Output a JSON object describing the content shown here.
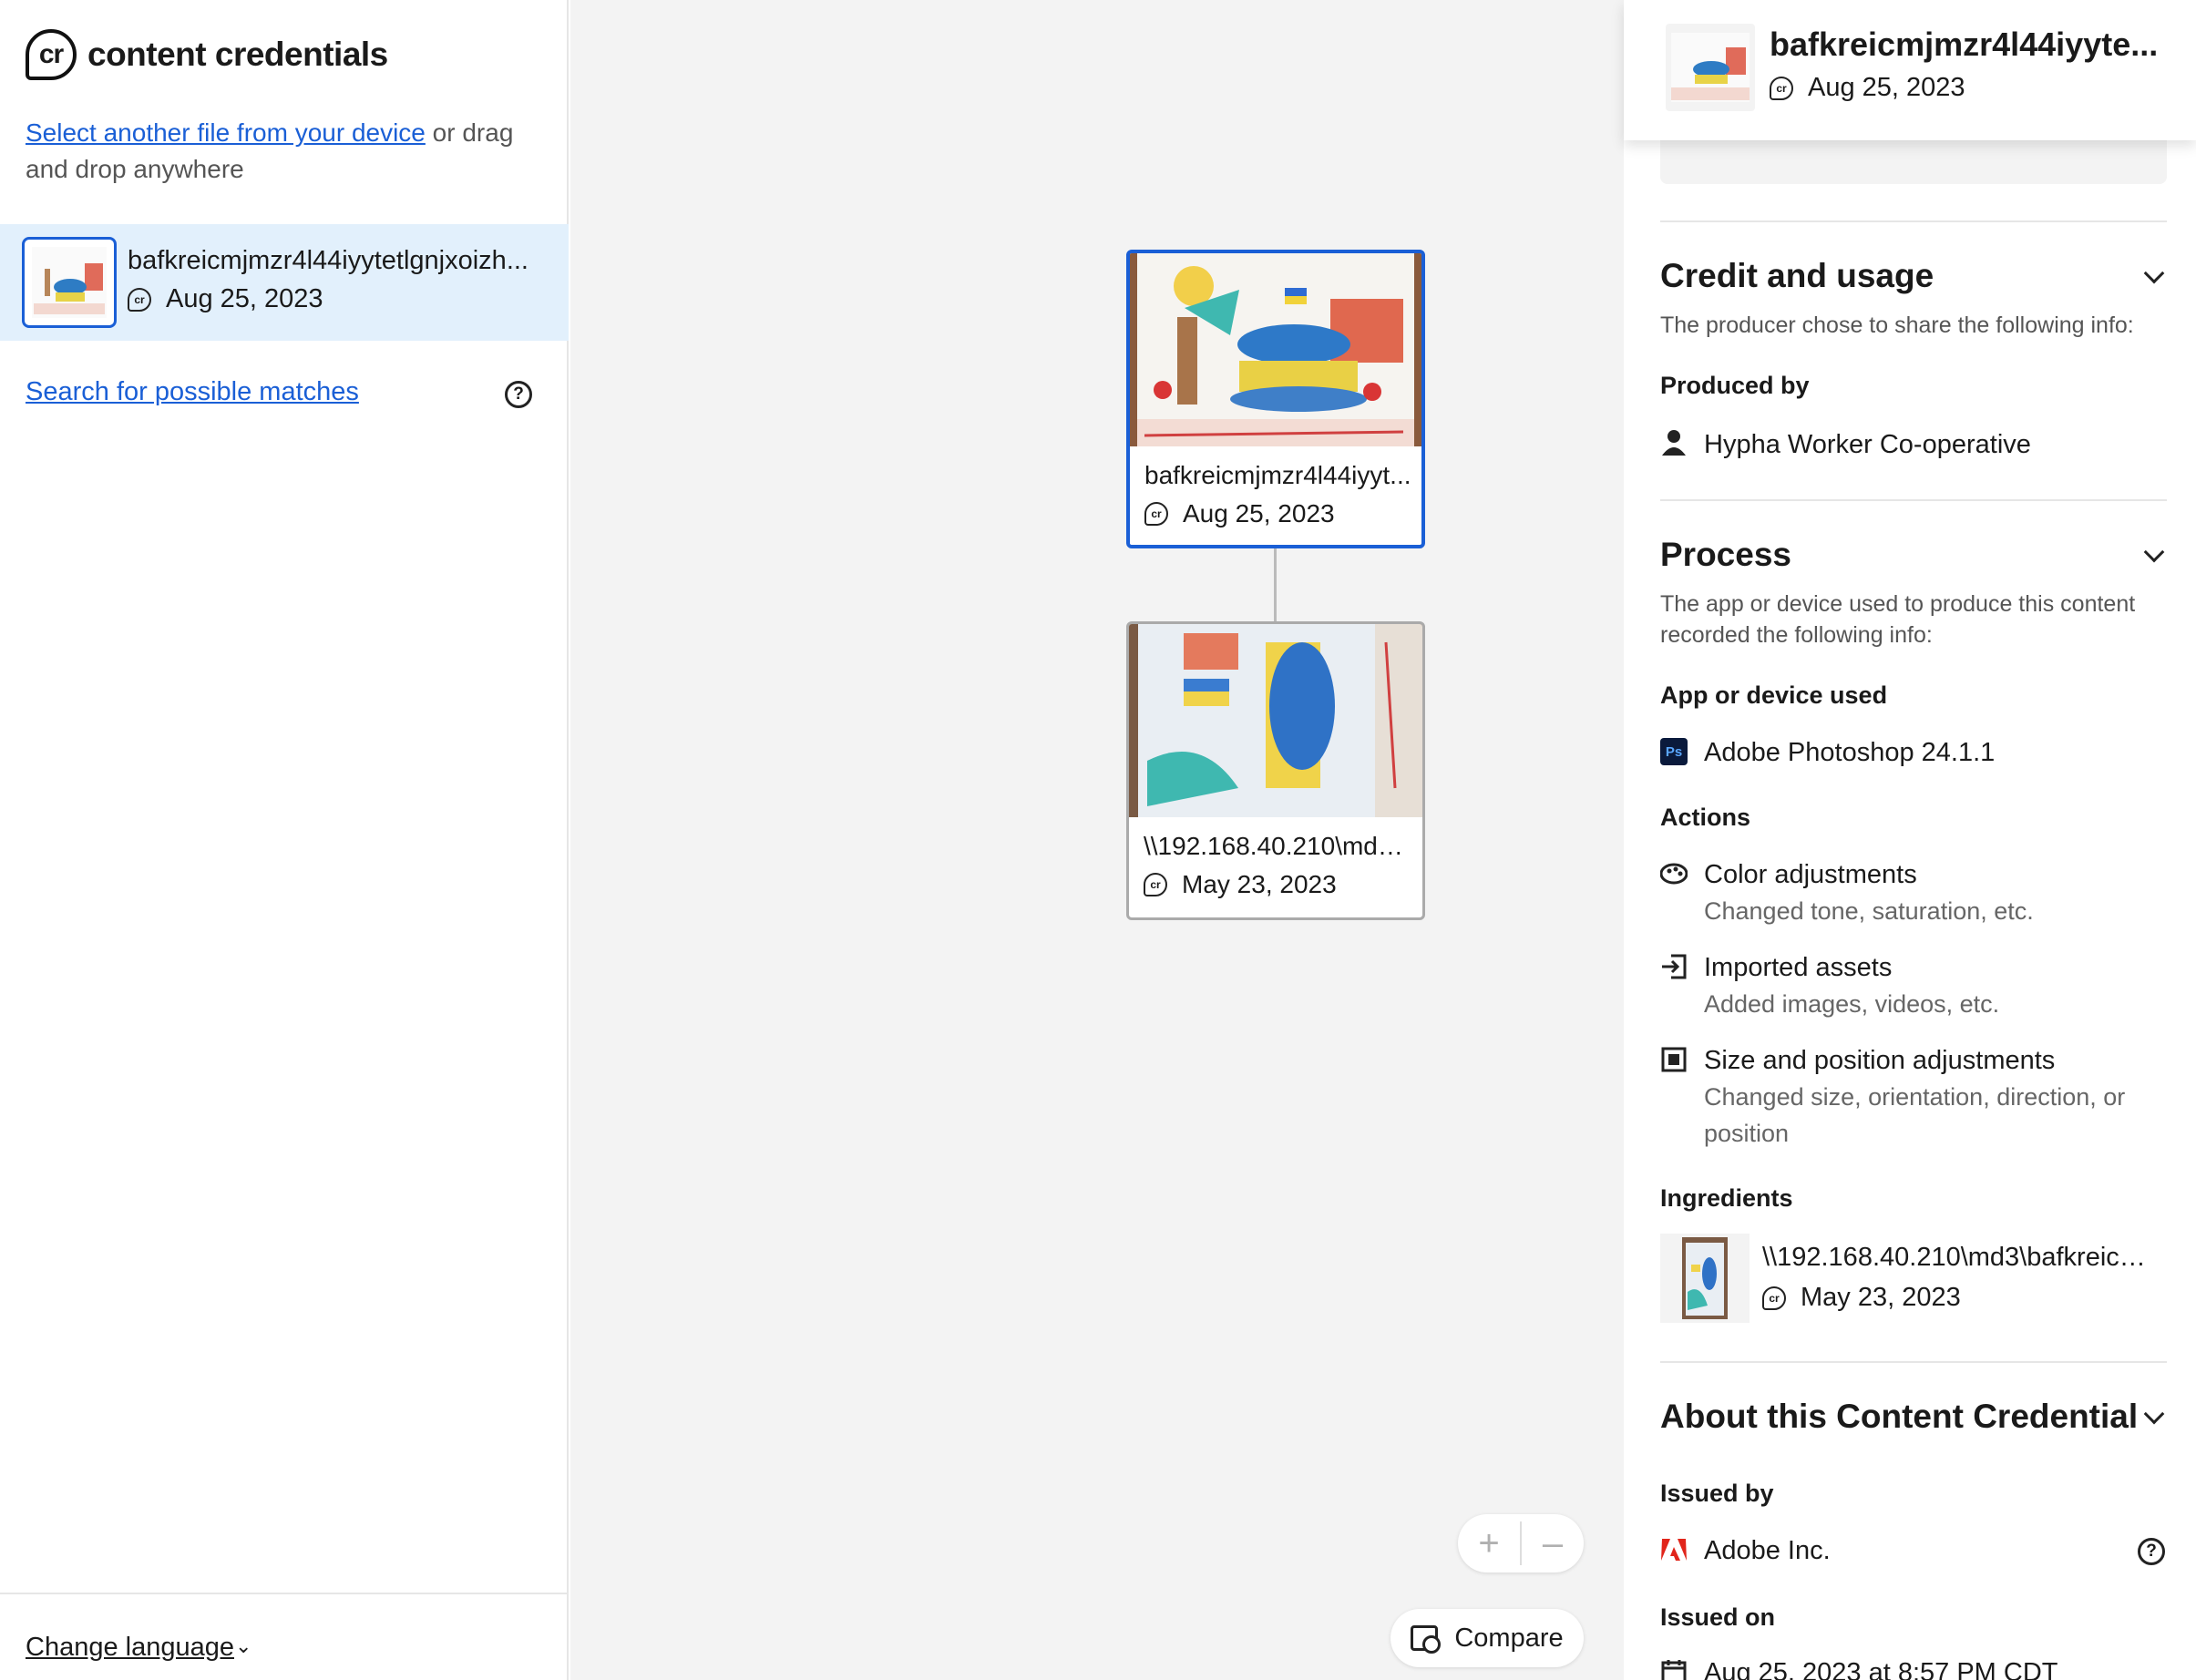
{
  "brand": {
    "mark": "cr",
    "name": "content credentials"
  },
  "left": {
    "select_link": "Select another file from your device",
    "select_rest": " or drag and drop anywhere",
    "file": {
      "name": "bafkreicmjmzr4l44iyytetlgnjxoizh...",
      "date": "Aug 25, 2023"
    },
    "search_link": "Search for possible matches",
    "help": "?",
    "language": "Change language",
    "language_chevron": "⌄"
  },
  "canvas": {
    "nodes": [
      {
        "title": "bafkreicmjmzr4l44iyyt...",
        "date": "Aug 25, 2023",
        "selected": true
      },
      {
        "title": "\\\\192.168.40.210\\md3\\b...",
        "date": "May 23, 2023",
        "selected": false
      }
    ],
    "zoom_in": "+",
    "zoom_out": "–",
    "compare": "Compare"
  },
  "right": {
    "header": {
      "title": "bafkreicmjmzr4l44iyyte...",
      "date": "Aug 25, 2023"
    },
    "credit": {
      "heading": "Credit and usage",
      "desc": "The producer chose to share the following info:",
      "produced_by_label": "Produced by",
      "produced_by": "Hypha Worker Co-operative"
    },
    "process": {
      "heading": "Process",
      "desc": "The app or device used to produce this content recorded the following info:",
      "app_label": "App or device used",
      "app_icon": "Ps",
      "app": "Adobe Photoshop 24.1.1",
      "actions_label": "Actions",
      "actions": [
        {
          "title": "Color adjustments",
          "desc": "Changed tone, saturation, etc.",
          "icon": "palette-icon"
        },
        {
          "title": "Imported assets",
          "desc": "Added images, videos, etc.",
          "icon": "import-icon"
        },
        {
          "title": "Size and position adjustments",
          "desc": "Changed size, orientation, direction, or position",
          "icon": "crop-icon"
        }
      ],
      "ingredients_label": "Ingredients",
      "ingredient": {
        "title": "\\\\192.168.40.210\\md3\\bafkreicmj...",
        "date": "May 23, 2023"
      }
    },
    "about": {
      "heading": "About this Content Credential",
      "issued_by_label": "Issued by",
      "issued_by": "Adobe Inc.",
      "issued_on_label": "Issued on",
      "issued_on": "Aug 25, 2023 at 8:57 PM CDT"
    }
  },
  "colors": {
    "accent": "#1a5fd6",
    "selected_bg": "#e2f0fc",
    "canvas_bg": "#f3f3f3",
    "adobe_red": "#e1251b"
  }
}
